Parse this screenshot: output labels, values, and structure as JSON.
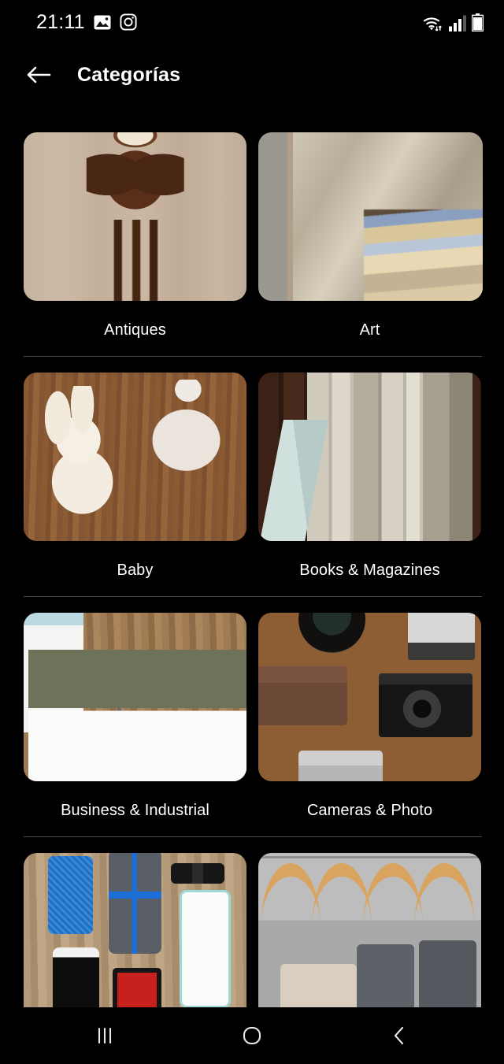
{
  "status_bar": {
    "clock": "21:11",
    "left_icons": [
      "photo-icon",
      "instagram-icon"
    ],
    "right_icons": [
      "wifi-icon",
      "signal-icon",
      "battery-icon"
    ],
    "signal_bars": 3,
    "battery_level": "full"
  },
  "header": {
    "back_icon": "back-arrow-icon",
    "title": "Categorías"
  },
  "theme": {
    "background": "#000000",
    "text": "#ffffff",
    "divider": "#4a4a4a"
  },
  "categories": [
    {
      "label": "Antiques",
      "image_alt": "Carved wooden cuckoo clock hanging on a pale wood wall",
      "art_class": "art-antiques"
    },
    {
      "label": "Art",
      "image_alt": "Silver gilt picture frame with impressionist landscape painting",
      "art_class": "art-art"
    },
    {
      "label": "Baby",
      "image_alt": "White plush bunny, knit baby hat, safety pin and silver rattle on wood",
      "art_class": "art-baby"
    },
    {
      "label": "Books & Magazines",
      "image_alt": "Row of art book spines including Van Gogh and Michelangelo on dark wood",
      "art_class": "art-books"
    },
    {
      "label": "Business & Industrial",
      "image_alt": "Calculator, green folder, contract and envelope with pen on a desk",
      "art_class": "art-business"
    },
    {
      "label": "Cameras & Photo",
      "image_alt": "Vintage brown and black cameras, lens and flash on a wooden table",
      "art_class": "art-cameras"
    },
    {
      "label": "",
      "image_alt": "Phone cases, earbuds and smartphones arranged on a wooden surface",
      "art_class": "art-phones"
    },
    {
      "label": "",
      "image_alt": "Wooden clothes hangers with grey and cream garments on a rail",
      "art_class": "art-clothes"
    }
  ],
  "navigation_bar": {
    "recents_label": "recents-icon",
    "home_label": "home-icon",
    "back_label": "back-icon"
  }
}
